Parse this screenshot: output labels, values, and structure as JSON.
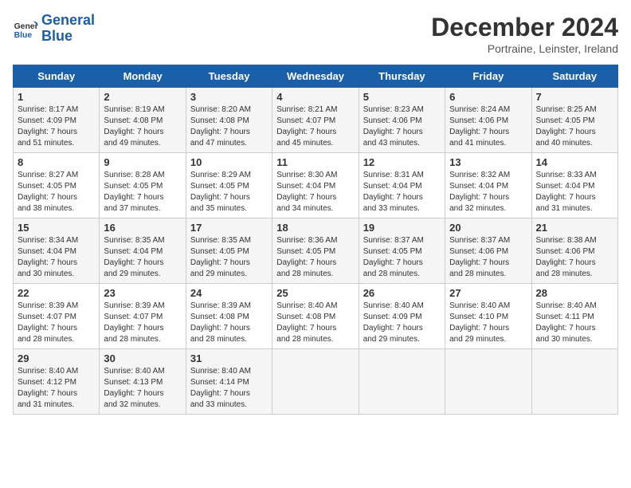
{
  "logo": {
    "line1": "General",
    "line2": "Blue"
  },
  "title": "December 2024",
  "location": "Portraine, Leinster, Ireland",
  "days_header": [
    "Sunday",
    "Monday",
    "Tuesday",
    "Wednesday",
    "Thursday",
    "Friday",
    "Saturday"
  ],
  "weeks": [
    [
      {
        "day": "1",
        "sunrise": "8:17 AM",
        "sunset": "4:09 PM",
        "daylight": "7 hours and 51 minutes."
      },
      {
        "day": "2",
        "sunrise": "8:19 AM",
        "sunset": "4:08 PM",
        "daylight": "7 hours and 49 minutes."
      },
      {
        "day": "3",
        "sunrise": "8:20 AM",
        "sunset": "4:08 PM",
        "daylight": "7 hours and 47 minutes."
      },
      {
        "day": "4",
        "sunrise": "8:21 AM",
        "sunset": "4:07 PM",
        "daylight": "7 hours and 45 minutes."
      },
      {
        "day": "5",
        "sunrise": "8:23 AM",
        "sunset": "4:06 PM",
        "daylight": "7 hours and 43 minutes."
      },
      {
        "day": "6",
        "sunrise": "8:24 AM",
        "sunset": "4:06 PM",
        "daylight": "7 hours and 41 minutes."
      },
      {
        "day": "7",
        "sunrise": "8:25 AM",
        "sunset": "4:05 PM",
        "daylight": "7 hours and 40 minutes."
      }
    ],
    [
      {
        "day": "8",
        "sunrise": "8:27 AM",
        "sunset": "4:05 PM",
        "daylight": "7 hours and 38 minutes."
      },
      {
        "day": "9",
        "sunrise": "8:28 AM",
        "sunset": "4:05 PM",
        "daylight": "7 hours and 37 minutes."
      },
      {
        "day": "10",
        "sunrise": "8:29 AM",
        "sunset": "4:05 PM",
        "daylight": "7 hours and 35 minutes."
      },
      {
        "day": "11",
        "sunrise": "8:30 AM",
        "sunset": "4:04 PM",
        "daylight": "7 hours and 34 minutes."
      },
      {
        "day": "12",
        "sunrise": "8:31 AM",
        "sunset": "4:04 PM",
        "daylight": "7 hours and 33 minutes."
      },
      {
        "day": "13",
        "sunrise": "8:32 AM",
        "sunset": "4:04 PM",
        "daylight": "7 hours and 32 minutes."
      },
      {
        "day": "14",
        "sunrise": "8:33 AM",
        "sunset": "4:04 PM",
        "daylight": "7 hours and 31 minutes."
      }
    ],
    [
      {
        "day": "15",
        "sunrise": "8:34 AM",
        "sunset": "4:04 PM",
        "daylight": "7 hours and 30 minutes."
      },
      {
        "day": "16",
        "sunrise": "8:35 AM",
        "sunset": "4:04 PM",
        "daylight": "7 hours and 29 minutes."
      },
      {
        "day": "17",
        "sunrise": "8:35 AM",
        "sunset": "4:05 PM",
        "daylight": "7 hours and 29 minutes."
      },
      {
        "day": "18",
        "sunrise": "8:36 AM",
        "sunset": "4:05 PM",
        "daylight": "7 hours and 28 minutes."
      },
      {
        "day": "19",
        "sunrise": "8:37 AM",
        "sunset": "4:05 PM",
        "daylight": "7 hours and 28 minutes."
      },
      {
        "day": "20",
        "sunrise": "8:37 AM",
        "sunset": "4:06 PM",
        "daylight": "7 hours and 28 minutes."
      },
      {
        "day": "21",
        "sunrise": "8:38 AM",
        "sunset": "4:06 PM",
        "daylight": "7 hours and 28 minutes."
      }
    ],
    [
      {
        "day": "22",
        "sunrise": "8:39 AM",
        "sunset": "4:07 PM",
        "daylight": "7 hours and 28 minutes."
      },
      {
        "day": "23",
        "sunrise": "8:39 AM",
        "sunset": "4:07 PM",
        "daylight": "7 hours and 28 minutes."
      },
      {
        "day": "24",
        "sunrise": "8:39 AM",
        "sunset": "4:08 PM",
        "daylight": "7 hours and 28 minutes."
      },
      {
        "day": "25",
        "sunrise": "8:40 AM",
        "sunset": "4:08 PM",
        "daylight": "7 hours and 28 minutes."
      },
      {
        "day": "26",
        "sunrise": "8:40 AM",
        "sunset": "4:09 PM",
        "daylight": "7 hours and 29 minutes."
      },
      {
        "day": "27",
        "sunrise": "8:40 AM",
        "sunset": "4:10 PM",
        "daylight": "7 hours and 29 minutes."
      },
      {
        "day": "28",
        "sunrise": "8:40 AM",
        "sunset": "4:11 PM",
        "daylight": "7 hours and 30 minutes."
      }
    ],
    [
      {
        "day": "29",
        "sunrise": "8:40 AM",
        "sunset": "4:12 PM",
        "daylight": "7 hours and 31 minutes."
      },
      {
        "day": "30",
        "sunrise": "8:40 AM",
        "sunset": "4:13 PM",
        "daylight": "7 hours and 32 minutes."
      },
      {
        "day": "31",
        "sunrise": "8:40 AM",
        "sunset": "4:14 PM",
        "daylight": "7 hours and 33 minutes."
      },
      null,
      null,
      null,
      null
    ]
  ]
}
